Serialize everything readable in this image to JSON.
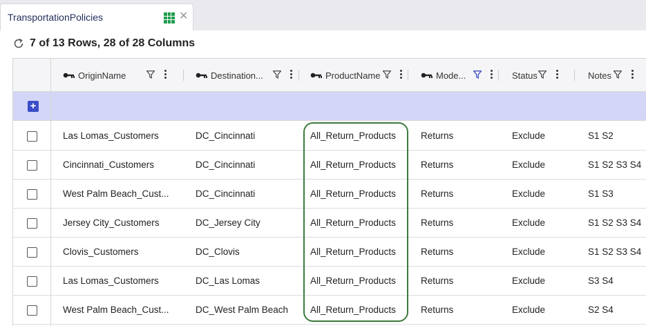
{
  "tab": {
    "title": "TransportationPolicies",
    "icon": "grid-icon",
    "close_glyph": "✕"
  },
  "summary": {
    "text": "7 of 13 Rows, 28 of 28 Columns"
  },
  "columns": [
    {
      "label": "OriginName",
      "key": true,
      "filter_active": false
    },
    {
      "label": "Destination...",
      "key": true,
      "filter_active": false
    },
    {
      "label": "ProductName",
      "key": true,
      "filter_active": false
    },
    {
      "label": "Mode...",
      "key": true,
      "filter_active": true
    },
    {
      "label": "Status",
      "key": false,
      "filter_active": false
    },
    {
      "label": "Notes",
      "key": false,
      "filter_active": false
    }
  ],
  "add_row": {
    "glyph": "+"
  },
  "rows": [
    {
      "origin": "Las Lomas_Customers",
      "destination": "DC_Cincinnati",
      "product": "All_Return_Products",
      "mode": "Returns",
      "status": "Exclude",
      "notes": "S1 S2"
    },
    {
      "origin": "Cincinnati_Customers",
      "destination": "DC_Cincinnati",
      "product": "All_Return_Products",
      "mode": "Returns",
      "status": "Exclude",
      "notes": "S1 S2 S3 S4"
    },
    {
      "origin": "West Palm Beach_Cust...",
      "destination": "DC_Cincinnati",
      "product": "All_Return_Products",
      "mode": "Returns",
      "status": "Exclude",
      "notes": "S1 S3"
    },
    {
      "origin": "Jersey City_Customers",
      "destination": "DC_Jersey City",
      "product": "All_Return_Products",
      "mode": "Returns",
      "status": "Exclude",
      "notes": "S1 S2 S3 S4"
    },
    {
      "origin": "Clovis_Customers",
      "destination": "DC_Clovis",
      "product": "All_Return_Products",
      "mode": "Returns",
      "status": "Exclude",
      "notes": "S1 S2 S3 S4"
    },
    {
      "origin": "Las Lomas_Customers",
      "destination": "DC_Las Lomas",
      "product": "All_Return_Products",
      "mode": "Returns",
      "status": "Exclude",
      "notes": "S3 S4"
    },
    {
      "origin": "West Palm Beach_Cust...",
      "destination": "DC_West Palm Beach",
      "product": "All_Return_Products",
      "mode": "Returns",
      "status": "Exclude",
      "notes": "S2 S4"
    }
  ],
  "colors": {
    "accent": "#3b4cc7",
    "add_row_bg": "#d4d6f7",
    "highlight": "#3c7a3c",
    "filter_active": "#3b4cc7"
  }
}
